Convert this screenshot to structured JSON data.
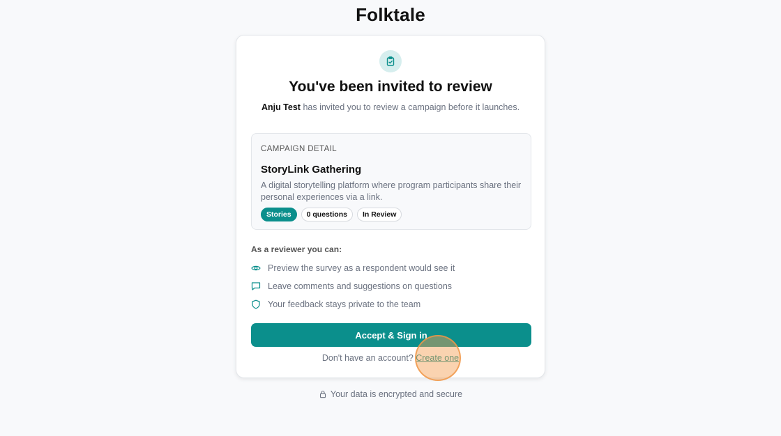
{
  "brand": "Folktale",
  "invite": {
    "title": "You've been invited to review",
    "inviter": "Anju Test",
    "message": "has invited you to review a campaign before it launches."
  },
  "campaign": {
    "section_label": "CAMPAIGN DETAIL",
    "name": "StoryLink Gathering",
    "description": "A digital storytelling platform where program participants share their personal experiences via a link.",
    "tags": [
      "Stories",
      "0 questions",
      "In Review"
    ]
  },
  "reviewer": {
    "heading": "As a reviewer you can:",
    "permissions": [
      {
        "icon": "eye-icon",
        "text": "Preview the survey as a respondent would see it"
      },
      {
        "icon": "comment-icon",
        "text": "Leave comments and suggestions on questions"
      },
      {
        "icon": "shield-icon",
        "text": "Your feedback stays private to the team"
      }
    ]
  },
  "actions": {
    "accept_label": "Accept & Sign in",
    "no_account_text": "Don't have an account?",
    "create_link": "Create one"
  },
  "footer": {
    "secure_text": "Your data is encrypted and secure"
  },
  "colors": {
    "accent": "#0b8f8c",
    "icon_bg": "#d6eeee",
    "page_bg": "#f8f9fb"
  }
}
